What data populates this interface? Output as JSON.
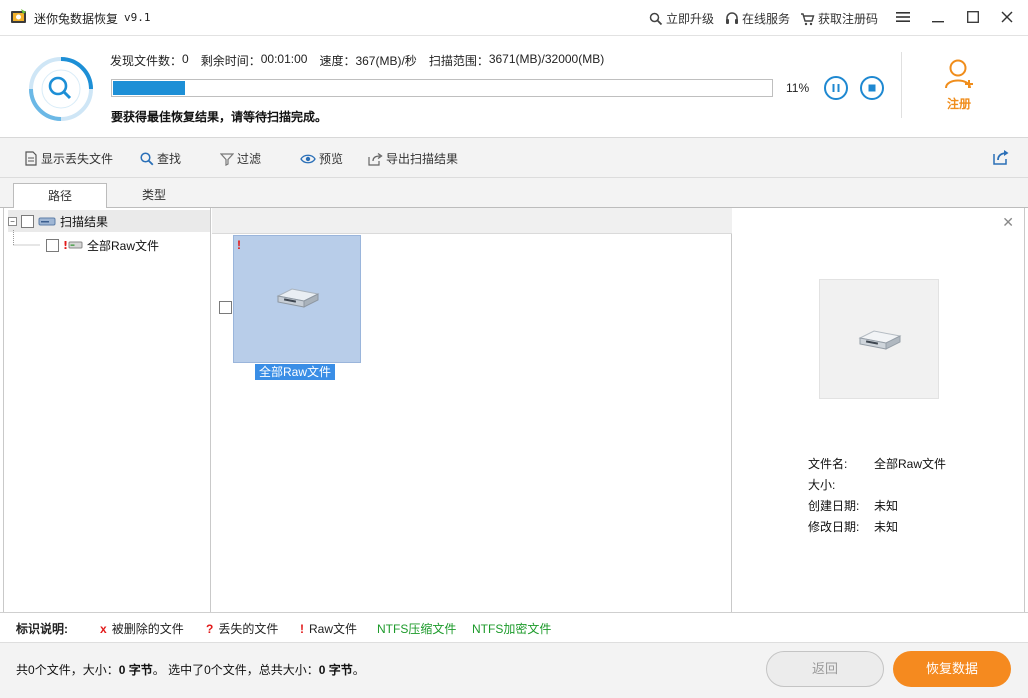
{
  "titlebar": {
    "app_title": "迷你兔数据恢复",
    "version": "v9.1",
    "links": {
      "upgrade": "立即升级",
      "online_service": "在线服务",
      "get_code": "获取注册码"
    }
  },
  "scan": {
    "found_label": "发现文件数：",
    "found_value": "0",
    "remain_label": "剩余时间：",
    "remain_value": "00:01:00",
    "speed_label": "速度：",
    "speed_value": "367(MB)/秒",
    "range_label": "扫描范围：",
    "range_value": "3671(MB)/32000(MB)",
    "progress": 0.11,
    "progress_text": "11%",
    "hint": "要获得最佳恢复结果，请等待扫描完成。",
    "register_label": "注册"
  },
  "toolbar": {
    "show_lost": "显示丢失文件",
    "find": "查找",
    "filter": "过滤",
    "preview": "预览",
    "export": "导出扫描结果"
  },
  "tabs": {
    "path": "路径",
    "type": "类型"
  },
  "tree": {
    "root": "扫描结果",
    "child": "全部Raw文件"
  },
  "grid": {
    "item_label": "全部Raw文件",
    "item_flag": "!"
  },
  "details": {
    "name_label": "文件名:",
    "name_value": "全部Raw文件",
    "size_label": "大小:",
    "size_value": "",
    "created_label": "创建日期:",
    "created_value": "未知",
    "modified_label": "修改日期:",
    "modified_value": "未知"
  },
  "legend": {
    "title": "标识说明:",
    "deleted_mark": "x",
    "deleted": "被删除的文件",
    "lost_mark": "?",
    "lost": "丢失的文件",
    "raw_mark": "!",
    "raw": "Raw文件",
    "ntfs_compressed": "NTFS压缩文件",
    "ntfs_encrypted": "NTFS加密文件"
  },
  "status": {
    "total_prefix": "共",
    "total_count": "0",
    "total_mid": "个文件，大小：",
    "total_size": "0 字节",
    "sel_prefix": "。 选中了",
    "sel_count": "0",
    "sel_mid": "个文件，总共大小：",
    "sel_size": "0 字节",
    "suffix": "。"
  },
  "buttons": {
    "back": "返回",
    "recover": "恢复数据"
  },
  "colors": {
    "accent_blue": "#1d8fd6",
    "orange": "#f58a1f",
    "legend_green": "#1c9a2a",
    "legend_red": "#e21a1a"
  }
}
